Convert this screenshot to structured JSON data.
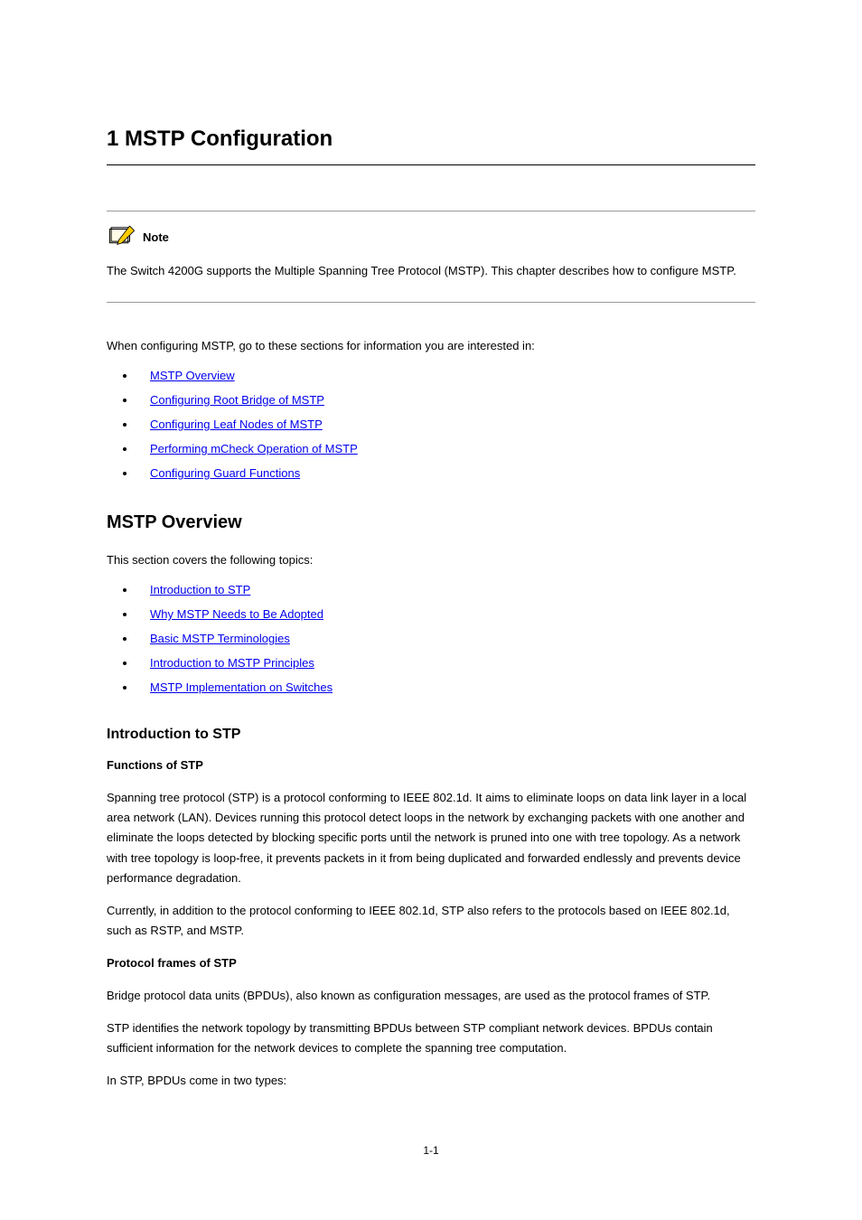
{
  "chapter": {
    "number_title": "1 MSTP Configuration"
  },
  "note": {
    "label": "Note",
    "text": "The Switch 4200G supports the Multiple Spanning Tree Protocol (MSTP). This chapter describes how to configure MSTP."
  },
  "intro1": "When configuring MSTP, go to these sections for information you are interested in:",
  "links1": [
    "MSTP Overview",
    "Configuring Root Bridge of MSTP",
    "Configuring Leaf Nodes of MSTP",
    "Performing mCheck Operation of MSTP",
    "Configuring Guard Functions"
  ],
  "section1": {
    "title": "MSTP Overview",
    "intro": "This section covers the following topics:",
    "links": [
      "Introduction to STP",
      "Why MSTP Needs to Be Adopted",
      "Basic MSTP Terminologies",
      "Introduction to MSTP Principles",
      "MSTP Implementation on Switches"
    ]
  },
  "subsection": {
    "title": "Introduction to STP",
    "h_functions": "Functions of STP",
    "p_functions": "Spanning tree protocol (STP) is a protocol conforming to IEEE 802.1d. It aims to eliminate loops on data link layer in a local area network (LAN). Devices running this protocol detect loops in the network by exchanging packets with one another and eliminate the loops detected by blocking specific ports until the network is pruned into one with tree topology. As a network with tree topology is loop-free, it prevents packets in it from being duplicated and forwarded endlessly and prevents device performance degradation.",
    "p_note": "Currently, in addition to the protocol conforming to IEEE 802.1d, STP also refers to the protocols based on IEEE 802.1d, such as RSTP, and MSTP.",
    "h_frames": "Protocol frames of STP",
    "p_frames": "Bridge protocol data units (BPDUs), also known as configuration messages, are used as the protocol frames of STP.",
    "p_bpdu": "STP identifies the network topology by transmitting BPDUs between STP compliant network devices. BPDUs contain sufficient information for the network devices to complete the spanning tree computation.",
    "p_types": "In STP, BPDUs come in two types:"
  },
  "page_number": "1-1"
}
